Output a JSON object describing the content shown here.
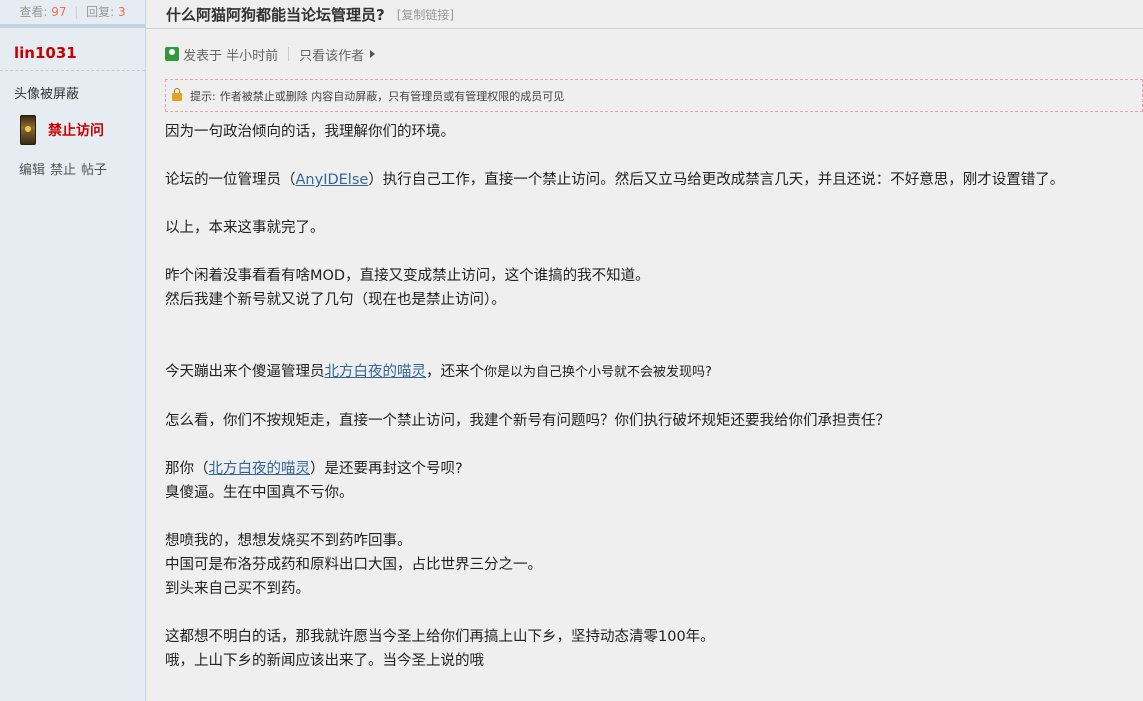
{
  "sidebar": {
    "stats": {
      "views_label": "查看:",
      "views": "97",
      "replies_label": "回复:",
      "replies": "3"
    },
    "author": "lin1031",
    "avatar_note": "头像被屏蔽",
    "ban_status": "禁止访问",
    "admin_links": [
      "编辑",
      "禁止",
      "帖子"
    ]
  },
  "thread": {
    "title": "什么阿猫阿狗都能当论坛管理员?",
    "copy_link": "[复制链接]"
  },
  "meta": {
    "posted": "发表于 半小时前",
    "only_author": "只看该作者"
  },
  "notice": {
    "prefix": "提示:",
    "text": "作者被禁止或删除 内容自动屏蔽，只有管理员或有管理权限的成员可见"
  },
  "post": {
    "p1": "因为一句政治倾向的话，我理解你们的环境。",
    "p2a": "论坛的一位管理员（",
    "p2_link": "AnyIDElse",
    "p2b": "）执行自己工作，直接一个禁止访问。然后又立马给更改成禁言几天，并且还说：不好意思，刚才设置错了。",
    "p3": "以上，本来这事就完了。",
    "p4": "昨个闲着没事看看有啥MOD，直接又变成禁止访问，这个谁搞的我不知道。",
    "p5": "然后我建个新号就又说了几句（现在也是禁止访问）。",
    "p6a": "今天蹦出来个傻逼管理员",
    "p6_link": "北方白夜的喵灵",
    "p6b": "，还来个",
    "p6c": "你是以为自己换个小号就不会被发现吗?",
    "p7": "怎么看，你们不按规矩走，直接一个禁止访问，我建个新号有问题吗？你们执行破坏规矩还要我给你们承担责任？",
    "p8a": "那你（",
    "p8_link": "北方白夜的喵灵",
    "p8b": "）是还要再封这个号呗?",
    "p9": "臭傻逼。生在中国真不亏你。",
    "p10": "想喷我的，想想发烧买不到药咋回事。",
    "p11": "中国可是布洛芬成药和原料出口大国，占比世界三分之一。",
    "p12": "到头来自己买不到药。",
    "p13": "这都想不明白的话，那我就许愿当今圣上给你们再搞上山下乡，坚持动态清零100年。",
    "p14": "哦，上山下乡的新闻应该出来了。当今圣上说的哦"
  }
}
